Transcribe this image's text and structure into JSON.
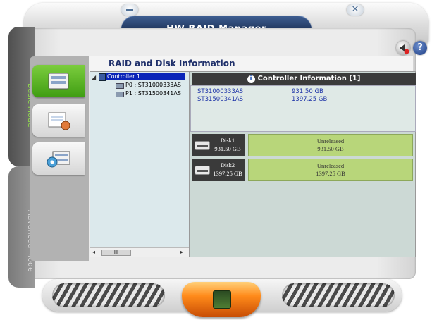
{
  "window": {
    "title": "HW RAID Manager"
  },
  "side_tabs": {
    "basic": "Basic Mode",
    "advanced": "Advanced Mode"
  },
  "panel": {
    "title": "RAID and Disk Information"
  },
  "tree": {
    "root": "Controller 1",
    "children": [
      "P0 : ST31000333AS",
      "P1 : ST31500341AS"
    ],
    "scroll_thumb": "III"
  },
  "controller_info": {
    "header": "Controller Information  [1]",
    "rows": [
      {
        "model": "ST31000333AS",
        "size": "931.50 GB"
      },
      {
        "model": "ST31500341AS",
        "size": "1397.25 GB"
      }
    ]
  },
  "disks": [
    {
      "label": "Disk1",
      "size": "931.50 GB",
      "status": "Unreleased",
      "status_size": "931.50 GB"
    },
    {
      "label": "Disk2",
      "size": "1397.25 GB",
      "status": "Unreleased",
      "status_size": "1397.25 GB"
    }
  ],
  "colors": {
    "accent_green": "#7ccd3e",
    "title_blue": "#1c3056",
    "status_green": "#b8d67a",
    "orange": "#ff8a1a"
  }
}
